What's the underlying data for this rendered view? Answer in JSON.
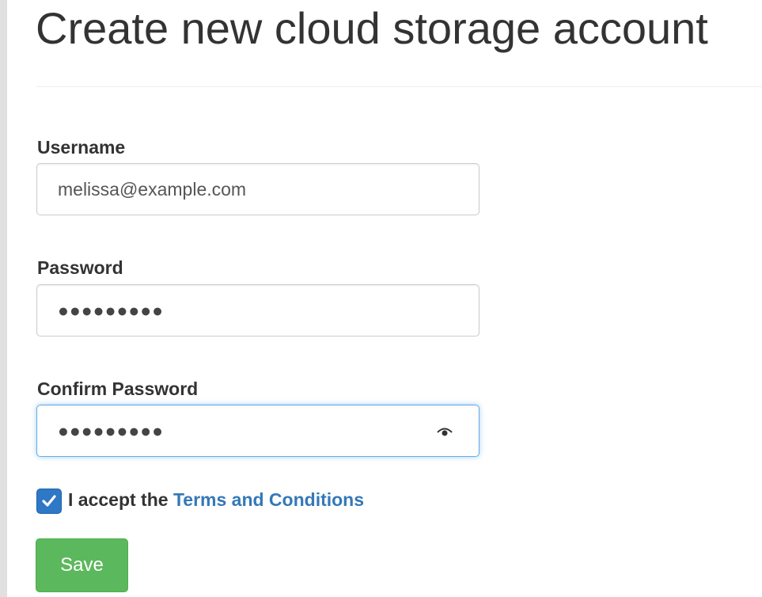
{
  "page": {
    "title": "Create new cloud storage account"
  },
  "form": {
    "username": {
      "label": "Username",
      "value": "melissa@example.com"
    },
    "password": {
      "label": "Password",
      "masked_value": "●●●●●●●●●"
    },
    "confirm_password": {
      "label": "Confirm Password",
      "masked_value": "●●●●●●●●●",
      "icon": "eye-icon",
      "focused": true
    },
    "terms": {
      "checked": true,
      "prefix": "I accept the",
      "link_text": "Terms and Conditions"
    },
    "save_label": "Save"
  },
  "colors": {
    "primary": "#337ab7",
    "success": "#5cb85c",
    "focus": "#66afe9"
  }
}
